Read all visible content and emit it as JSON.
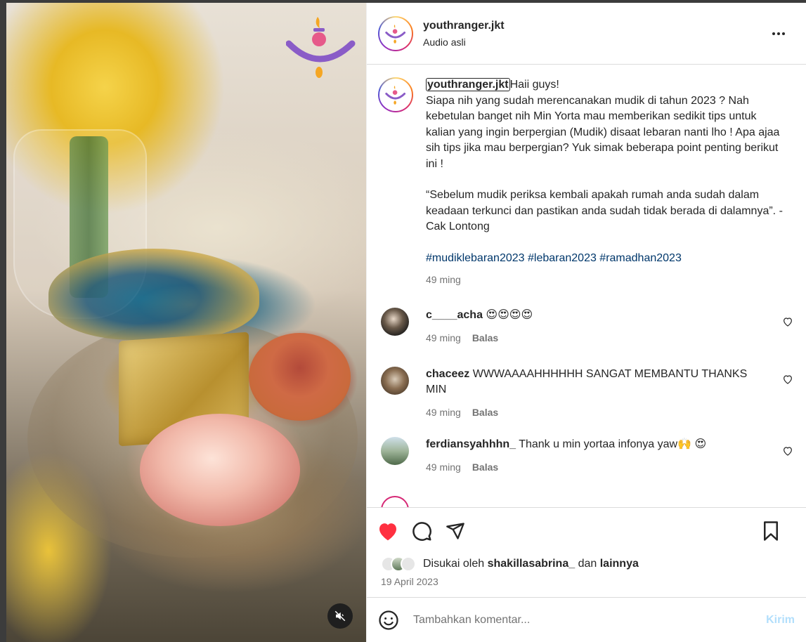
{
  "post": {
    "username": "youthranger.jkt",
    "audio": "Audio asli",
    "caption": {
      "username": "youthranger.jkt",
      "greeting": "Haii guys!",
      "paragraph1": "Siapa nih yang sudah merencanakan mudik di tahun 2023 ? Nah kebetulan banget nih Min Yorta mau memberikan sedikit tips untuk kalian yang ingin berpergian (Mudik) disaat lebaran nanti lho ! Apa ajaa sih tips jika mau berpergian? Yuk simak beberapa point penting berikut ini !",
      "paragraph2": "“Sebelum mudik periksa kembali apakah rumah anda sudah dalam keadaan terkunci dan pastikan anda sudah tidak berada di dalamnya”. - Cak Lontong",
      "hashtags": "#mudiklebaran2023 #lebaran2023 #ramadhan2023",
      "time": "49 ming"
    },
    "comments": [
      {
        "user": "c____acha",
        "text": "😍😍😍😍",
        "time": "49 ming",
        "reply": "Balas",
        "avatar_color": "#3a3a3a"
      },
      {
        "user": "chaceez",
        "text": "WWWAAAAHHHHHH SANGAT MEMBANTU THANKS MIN",
        "time": "49 ming",
        "reply": "Balas",
        "avatar_color": "#8a7a6a"
      },
      {
        "user": "ferdiansyahhhn_",
        "text": "Thank u min yortaa infonya yaw🙌 😍",
        "time": "49 ming",
        "reply": "Balas",
        "avatar_color": "#6b8a6b"
      }
    ],
    "likes": {
      "prefix": "Disukai oleh",
      "user": "shakillasabrina_",
      "middle": "dan",
      "suffix": "lainnya"
    },
    "date": "19 April 2023",
    "add_comment": {
      "placeholder": "Tambahkan komentar...",
      "post_label": "Kirim"
    }
  },
  "colors": {
    "like_red": "#ff3040",
    "hashtag": "#00376b",
    "meta_gray": "#737373",
    "post_disabled": "#b2dffc",
    "logo_purple": "#8a5cc7",
    "logo_pink": "#e65a8a",
    "logo_orange": "#f5a623"
  }
}
